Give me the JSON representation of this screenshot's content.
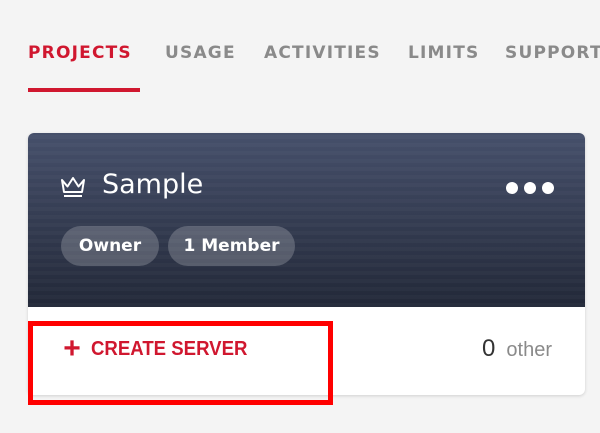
{
  "tabs": [
    {
      "label": "PROJECTS",
      "active": true
    },
    {
      "label": "USAGE",
      "active": false
    },
    {
      "label": "ACTIVITIES",
      "active": false
    },
    {
      "label": "LIMITS",
      "active": false
    },
    {
      "label": "SUPPORT",
      "active": false
    }
  ],
  "project_card": {
    "icon": "crown-icon",
    "title": "Sample",
    "menu_icon": "more-options-icon",
    "badges": [
      "Owner",
      "1 Member"
    ],
    "create_button": {
      "icon": "plus-icon",
      "label": "CREATE SERVER"
    },
    "count": {
      "value": "0",
      "label": "other"
    }
  },
  "colors": {
    "accent": "#d0172f",
    "tab_inactive": "#8a8a8a",
    "header_top": "#46506b",
    "header_bottom": "#222838",
    "background": "#f4f4f4",
    "annotation_box": "#ff0000"
  }
}
